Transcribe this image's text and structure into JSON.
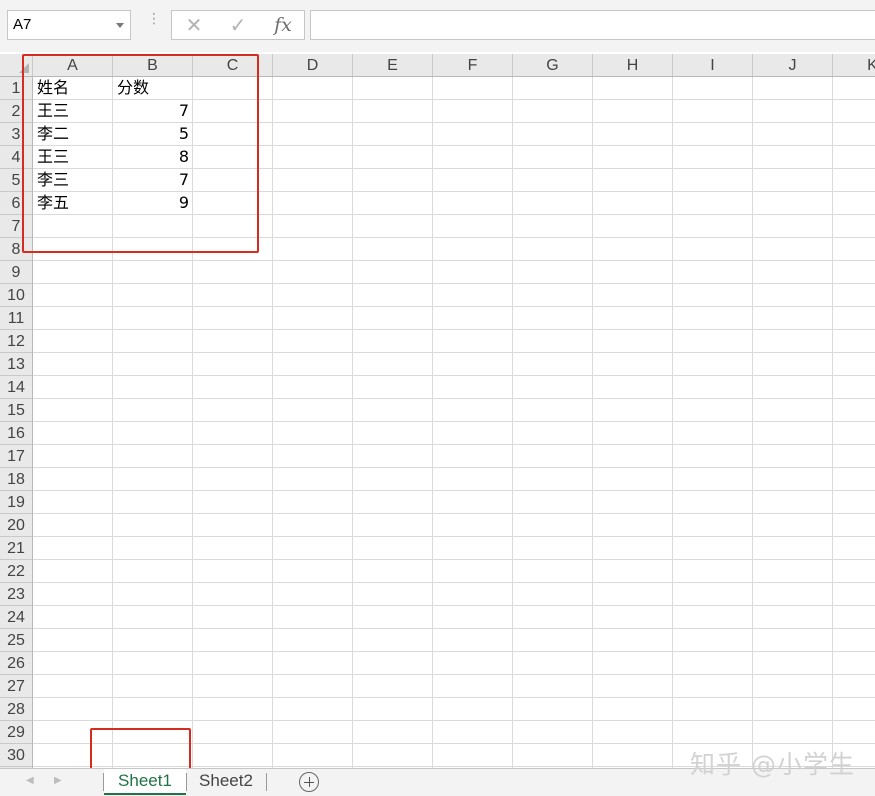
{
  "formula_bar": {
    "name_box": "A7",
    "separator": "⋮",
    "cancel_glyph": "✕",
    "enter_glyph": "✓",
    "fx_label": "fx",
    "formula": ""
  },
  "columns": [
    "A",
    "B",
    "C",
    "D",
    "E",
    "F",
    "G",
    "H",
    "I",
    "J",
    "K"
  ],
  "rows": [
    "1",
    "2",
    "3",
    "4",
    "5",
    "6",
    "7",
    "8",
    "9",
    "10",
    "11",
    "12",
    "13",
    "14",
    "15",
    "16",
    "17",
    "18",
    "19",
    "20",
    "21",
    "22",
    "23",
    "24",
    "25",
    "26",
    "27",
    "28",
    "29",
    "30"
  ],
  "table": {
    "header": {
      "a": "姓名",
      "b": "分数"
    },
    "rows": [
      {
        "a": "王三",
        "b": "7"
      },
      {
        "a": "李二",
        "b": "5"
      },
      {
        "a": "王三",
        "b": "8"
      },
      {
        "a": "李三",
        "b": "7"
      },
      {
        "a": "李五",
        "b": "9"
      }
    ]
  },
  "sheet_tabs": {
    "tabs": [
      "Sheet1",
      "Sheet2"
    ],
    "active": "Sheet1",
    "prev_arrow": "◀",
    "next_arrow": "▶"
  },
  "watermark": "知乎 @小学生",
  "colors": {
    "active_tab": "#217346",
    "highlight": "#d62c20"
  }
}
